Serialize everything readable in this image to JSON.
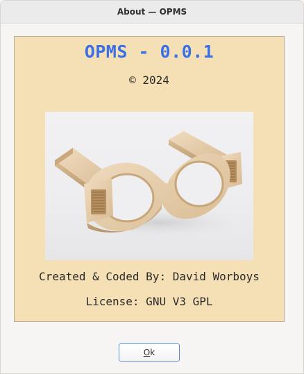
{
  "window": {
    "title": "About — OPMS"
  },
  "about": {
    "app_title": "OPMS - 0.0.1",
    "copyright": "© 2024",
    "image_alt": "wooden-glasses-image",
    "credit": "Created & Coded By: David Worboys",
    "license": "License: GNU V3 GPL"
  },
  "buttons": {
    "ok_mnemonic": "O",
    "ok_rest": "k"
  },
  "colors": {
    "panel_bg": "#f5dfb5",
    "title_accent": "#3a6fe8",
    "button_focus": "#5b8fd6"
  }
}
